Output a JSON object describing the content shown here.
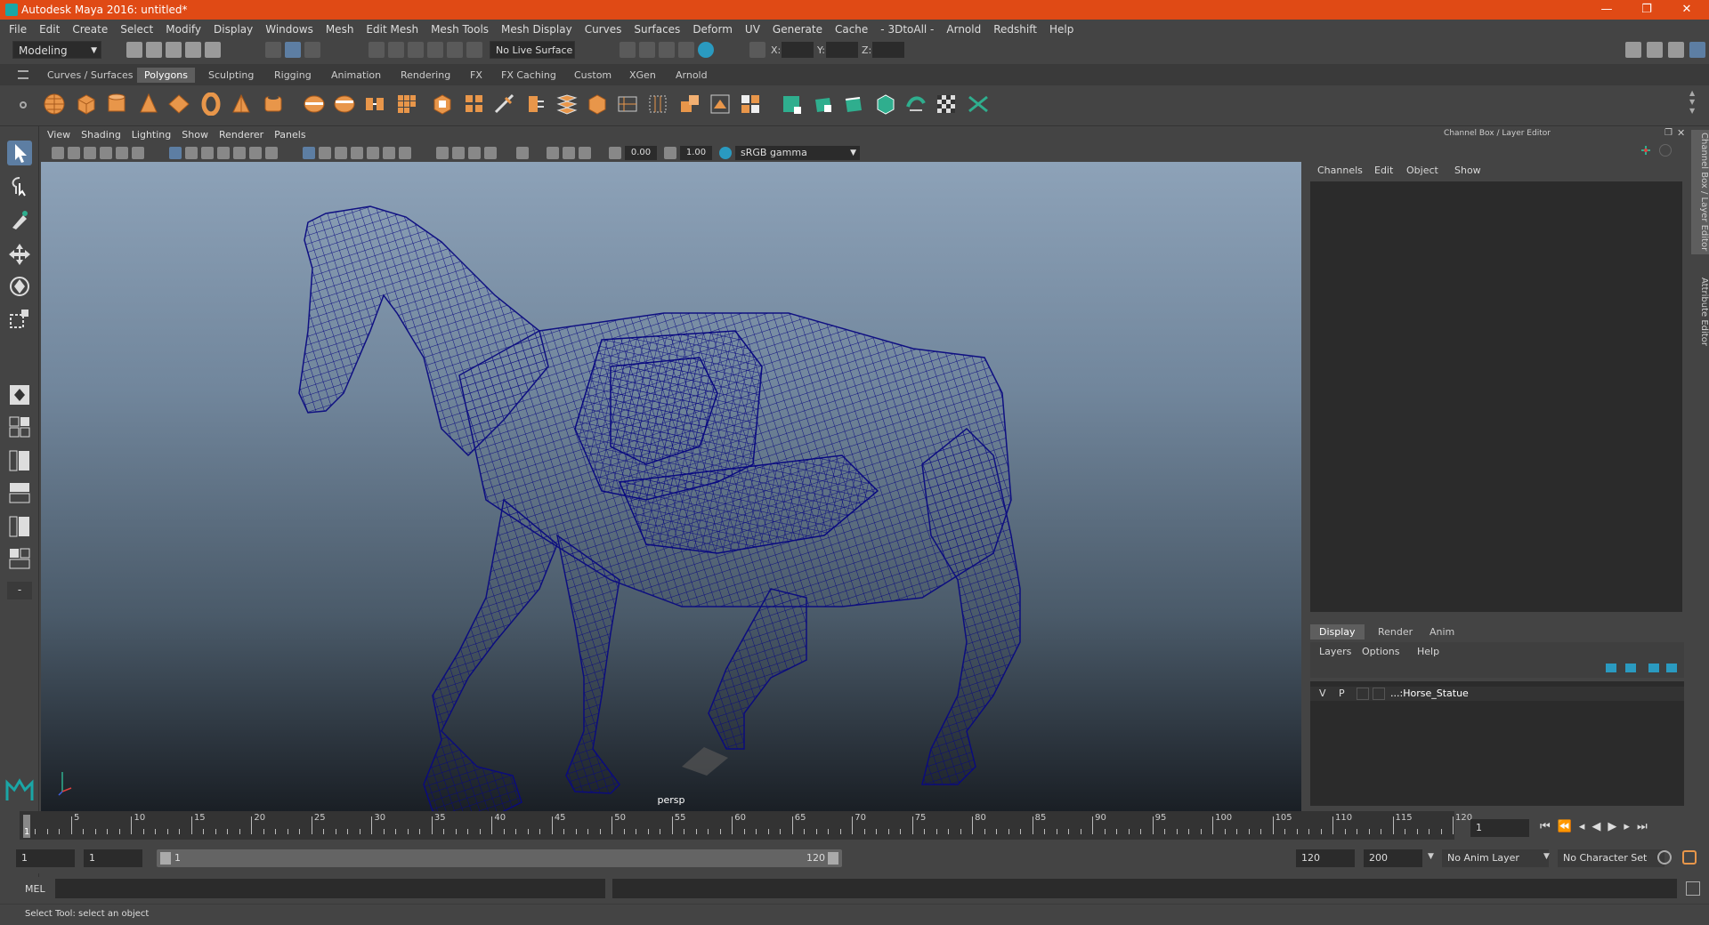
{
  "window": {
    "title": "Autodesk Maya 2016: untitled*",
    "controls": [
      "—",
      "❐",
      "✕"
    ]
  },
  "menubar": [
    "File",
    "Edit",
    "Create",
    "Select",
    "Modify",
    "Display",
    "Windows",
    "Mesh",
    "Edit Mesh",
    "Mesh Tools",
    "Mesh Display",
    "Curves",
    "Surfaces",
    "Deform",
    "UV",
    "Generate",
    "Cache",
    "- 3DtoAll -",
    "Arnold",
    "Redshift",
    "Help"
  ],
  "statusline": {
    "menuset": "Modeling",
    "live_surface": "No Live Surface",
    "x_label": "X:",
    "y_label": "Y:",
    "z_label": "Z:"
  },
  "shelf_tabs": [
    "Curves / Surfaces",
    "Polygons",
    "Sculpting",
    "Rigging",
    "Animation",
    "Rendering",
    "FX",
    "FX Caching",
    "Custom",
    "XGen",
    "Arnold"
  ],
  "active_shelf": "Polygons",
  "viewport": {
    "menus": [
      "View",
      "Shading",
      "Lighting",
      "Show",
      "Renderer",
      "Panels"
    ],
    "exposure": "0.00",
    "gamma": "1.00",
    "color_space": "sRGB gamma",
    "camera_label": "persp"
  },
  "channel_box": {
    "title": "Channel Box / Layer Editor",
    "menus": [
      "Channels",
      "Edit",
      "Object",
      "Show"
    ]
  },
  "layer_editor": {
    "tabs": [
      "Display",
      "Render",
      "Anim"
    ],
    "active_tab": "Display",
    "menus": [
      "Layers",
      "Options",
      "Help"
    ],
    "layers": [
      {
        "v": "V",
        "p": "P",
        "name": "...:Horse_Statue"
      }
    ]
  },
  "side_tabs": [
    "Channel Box / Layer Editor",
    "Attribute Editor"
  ],
  "timeline": {
    "ticks": [
      5,
      10,
      15,
      20,
      25,
      30,
      35,
      40,
      45,
      50,
      55,
      60,
      65,
      70,
      75,
      80,
      85,
      90,
      95,
      100,
      105,
      110,
      115,
      120
    ],
    "start_label": "1",
    "current_frame": "1"
  },
  "range": {
    "start": "1",
    "playback_start": "1",
    "slider_start": "1",
    "slider_end": "120",
    "playback_end": "120",
    "end": "200",
    "anim_layer": "No Anim Layer",
    "character_set": "No Character Set"
  },
  "command_line": {
    "label": "MEL"
  },
  "help_line": "Select Tool: select an object",
  "colors": {
    "titlebar": "#e04a15",
    "wireframe": "#0a0a80",
    "shelf_icon": "#e8964a",
    "shelf_icon_green": "#2fae8e"
  }
}
